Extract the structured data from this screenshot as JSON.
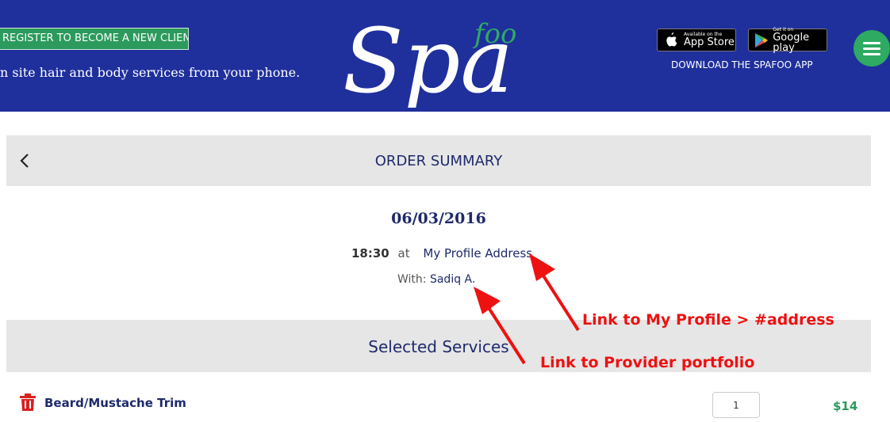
{
  "header": {
    "register_label": "REGISTER TO BECOME A NEW CLIENT",
    "tagline": "n site hair and body services from your phone.",
    "logo": {
      "main": "Spa",
      "accent": "foo",
      "icon": "spafoo-logo"
    },
    "app_store": {
      "small": "Available on the",
      "big": "App Store",
      "icon": "apple-icon"
    },
    "google_play": {
      "small": "Get it on",
      "big": "Google play",
      "icon": "play-icon"
    },
    "download_text": "DOWNLOAD THE SPAFOO APP",
    "menu_icon": "hamburger-menu-icon"
  },
  "order": {
    "title": "ORDER SUMMARY",
    "back_icon": "chevron-left-icon",
    "date": "06/03/2016",
    "time": "18:30",
    "at": "at",
    "address_link": "My Profile Address",
    "with_label": "With:",
    "provider_link": "Sadiq A."
  },
  "services": {
    "title": "Selected Services",
    "items": [
      {
        "name": "Beard/Mustache Trim",
        "quantity": "1",
        "price": "$14",
        "delete_icon": "trash-icon"
      }
    ]
  },
  "annotations": [
    {
      "text": "Link to My Profile > #address"
    },
    {
      "text": "Link to Provider portfolio"
    }
  ],
  "colors": {
    "header_bg": "#1f2f9c",
    "accent_green": "#2b9a5c",
    "navy_text": "#1f2a6b",
    "annotation_red": "#ee1111",
    "section_bg": "#e6e6e6"
  }
}
